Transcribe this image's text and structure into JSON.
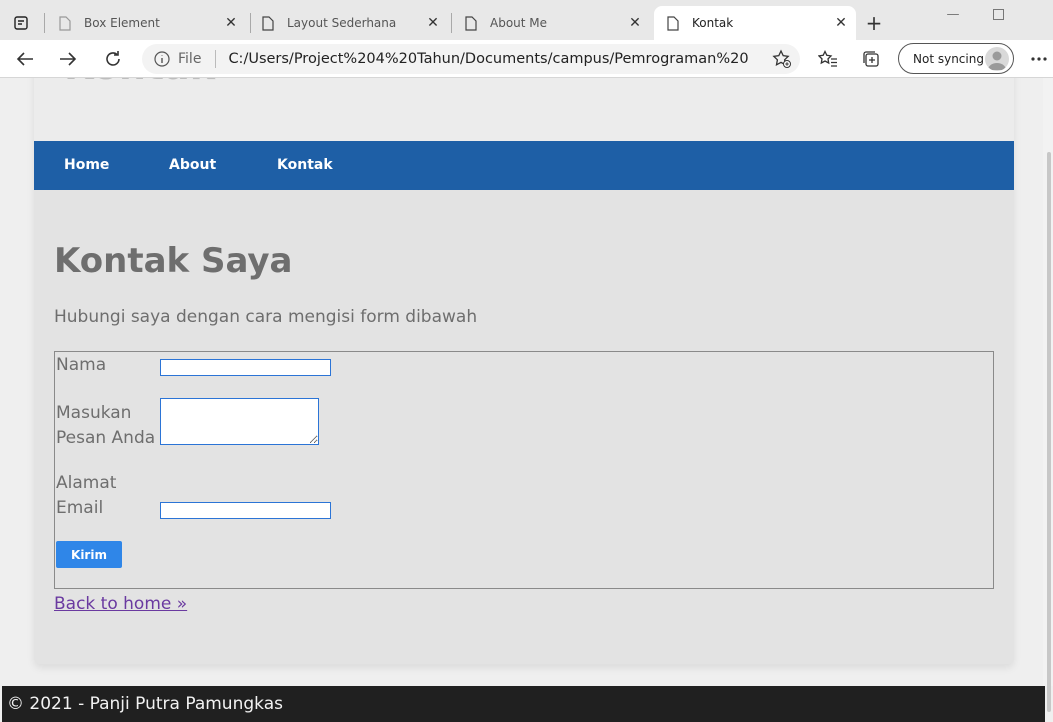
{
  "browser": {
    "tabs": [
      {
        "title": "Box Element",
        "active": false
      },
      {
        "title": "Layout Sederhana",
        "active": false
      },
      {
        "title": "About Me",
        "active": false
      },
      {
        "title": "Kontak",
        "active": true
      }
    ],
    "address": {
      "scheme_label": "File",
      "url": "C:/Users/Project%204%20Tahun/Documents/campus/Pemrograman%20..."
    },
    "profile": {
      "sync_label": "Not syncing"
    },
    "icons": {
      "app": "tab-actions-icon",
      "tab": "page-icon",
      "close": "close-icon",
      "new_tab": "plus-icon",
      "back": "back-arrow-icon",
      "forward": "forward-arrow-icon",
      "refresh": "refresh-icon",
      "info": "info-icon",
      "favorite_add": "star-plus-icon",
      "favorites": "favorites-icon",
      "collections": "collections-icon",
      "more": "more-icon"
    }
  },
  "page": {
    "site_title": "Kontak",
    "nav": [
      {
        "label": "Home"
      },
      {
        "label": "About"
      },
      {
        "label": "Kontak"
      }
    ],
    "heading": "Kontak Saya",
    "lead": "Hubungi saya dengan cara mengisi form dibawah",
    "form": {
      "name_label": "Nama",
      "message_label_1": "Masukan",
      "message_label_2": "Pesan Anda",
      "email_label_1": "Alamat",
      "email_label_2": "Email",
      "name_value": "",
      "message_value": "",
      "email_value": "",
      "submit_label": "Kirim"
    },
    "back_link": "Back to home »",
    "footer": "© 2021 - Panji Putra Pamungkas"
  },
  "colors": {
    "nav_bg": "#1e5fa6",
    "button_bg": "#2f86e8",
    "link_visited": "#6a3aa0",
    "footer_bg": "#202020"
  }
}
